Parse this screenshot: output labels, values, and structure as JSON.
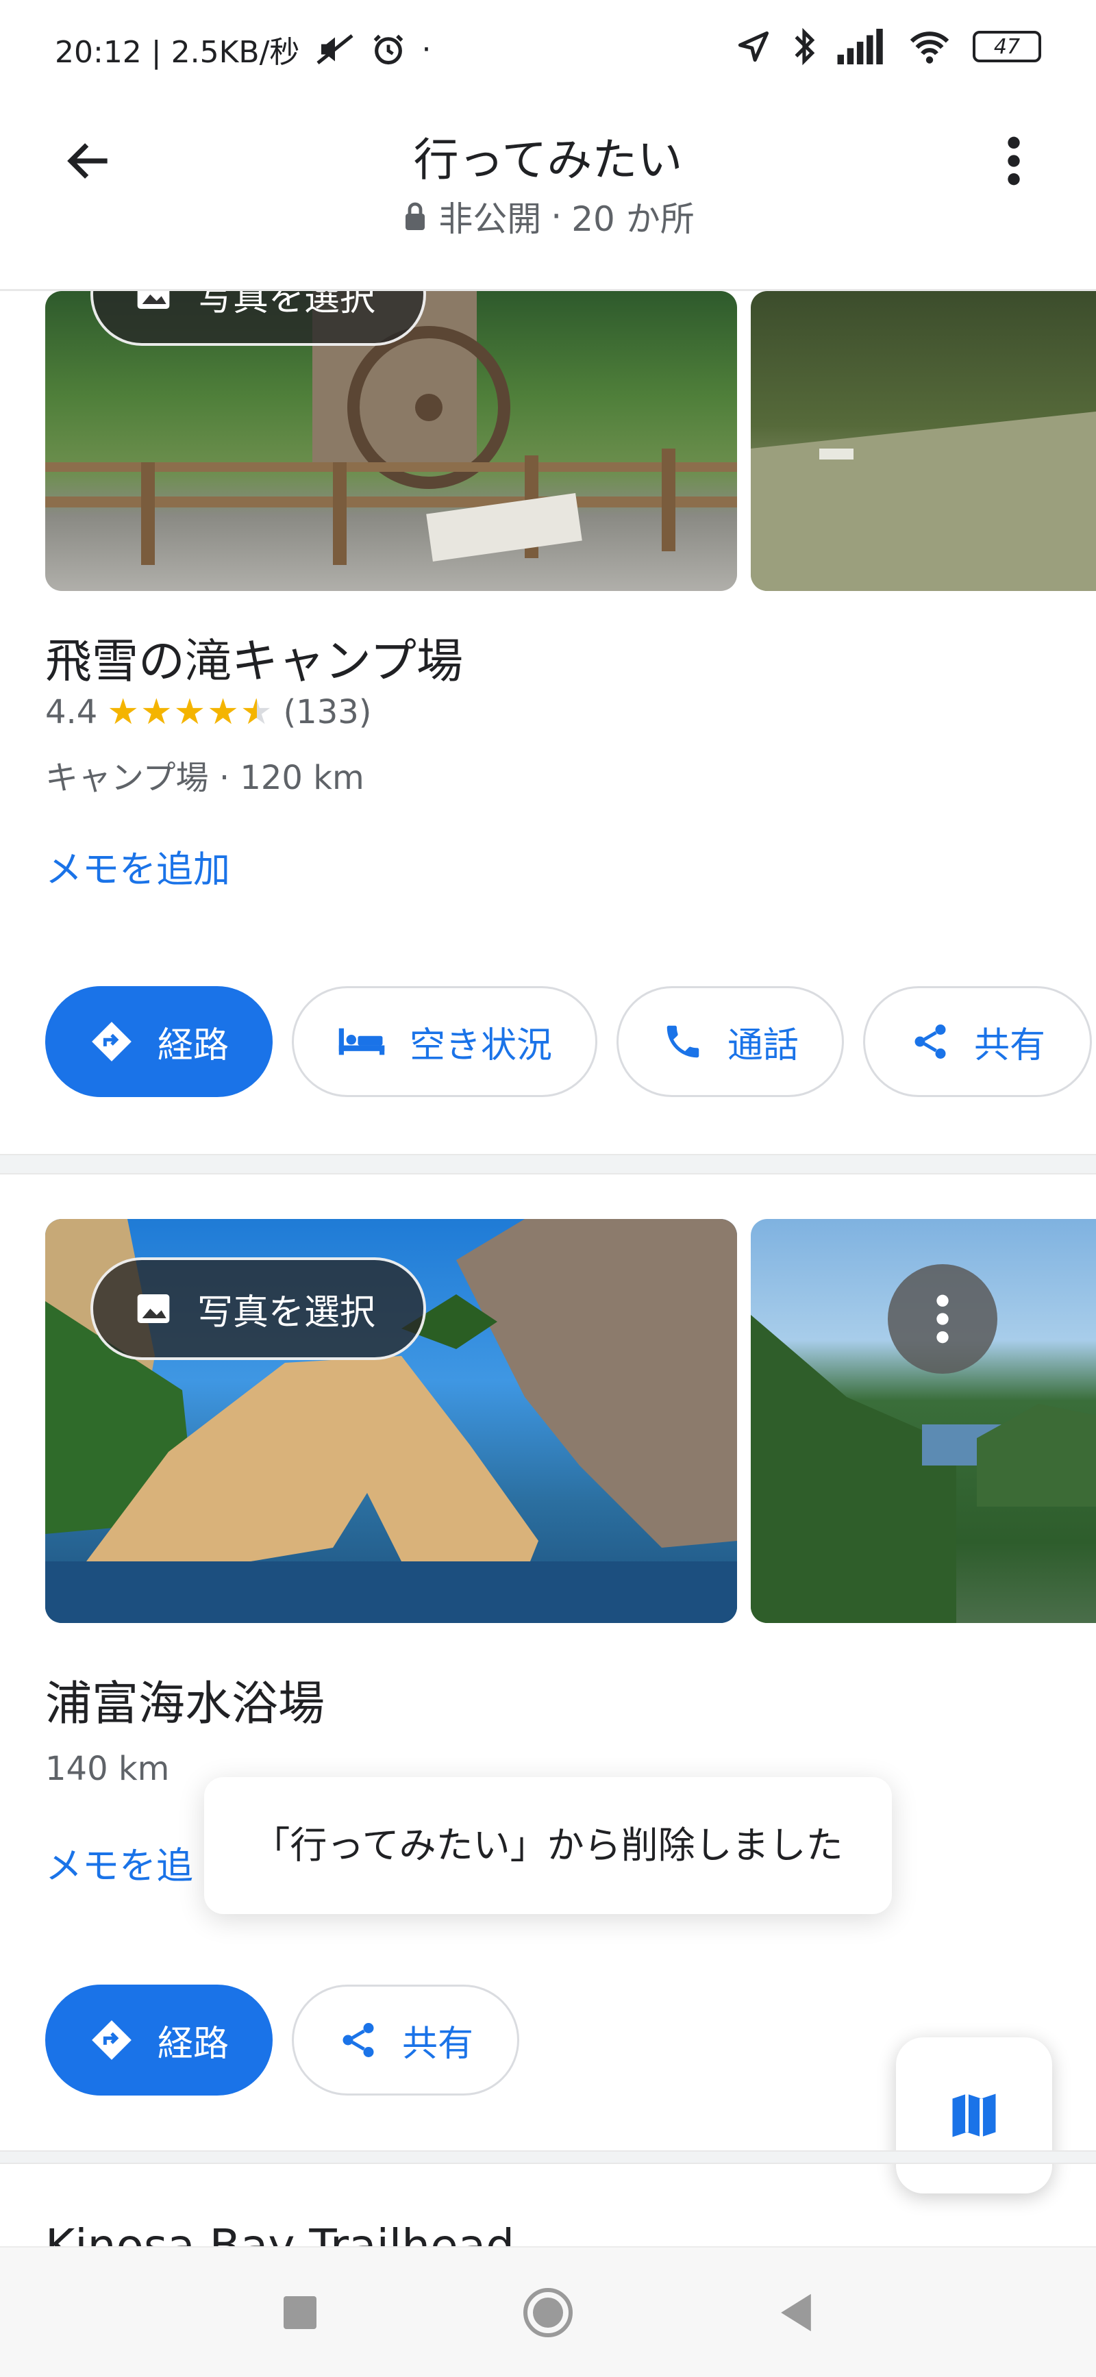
{
  "status_bar": {
    "time_speed": "20:12 | 2.5KB/秒",
    "dot": "·",
    "battery": "47"
  },
  "header": {
    "title": "行ってみたい",
    "privacy": "非公開",
    "separator": "·",
    "count": "20 か所"
  },
  "places": [
    {
      "name": "飛雪の滝キャンプ場",
      "rating": "4.4",
      "stars": 4.4,
      "reviews": "(133)",
      "meta": "キャンプ場 · 120 km",
      "photo_chip": "写真を選択",
      "memo": "メモを追加",
      "actions": [
        "経路",
        "空き状況",
        "通話",
        "共有"
      ]
    },
    {
      "name": "浦富海水浴場",
      "meta": "140 km",
      "photo_chip": "写真を選択",
      "memo": "メモを追",
      "actions": [
        "経路",
        "共有"
      ]
    }
  ],
  "next_place_partial": "Kinosa Bay Trailhead",
  "snackbar": "「行ってみたい」から削除しました",
  "colors": {
    "accent": "#1a73e8",
    "star": "#f4b400",
    "text": "#202124",
    "secondary": "#5f6368"
  }
}
